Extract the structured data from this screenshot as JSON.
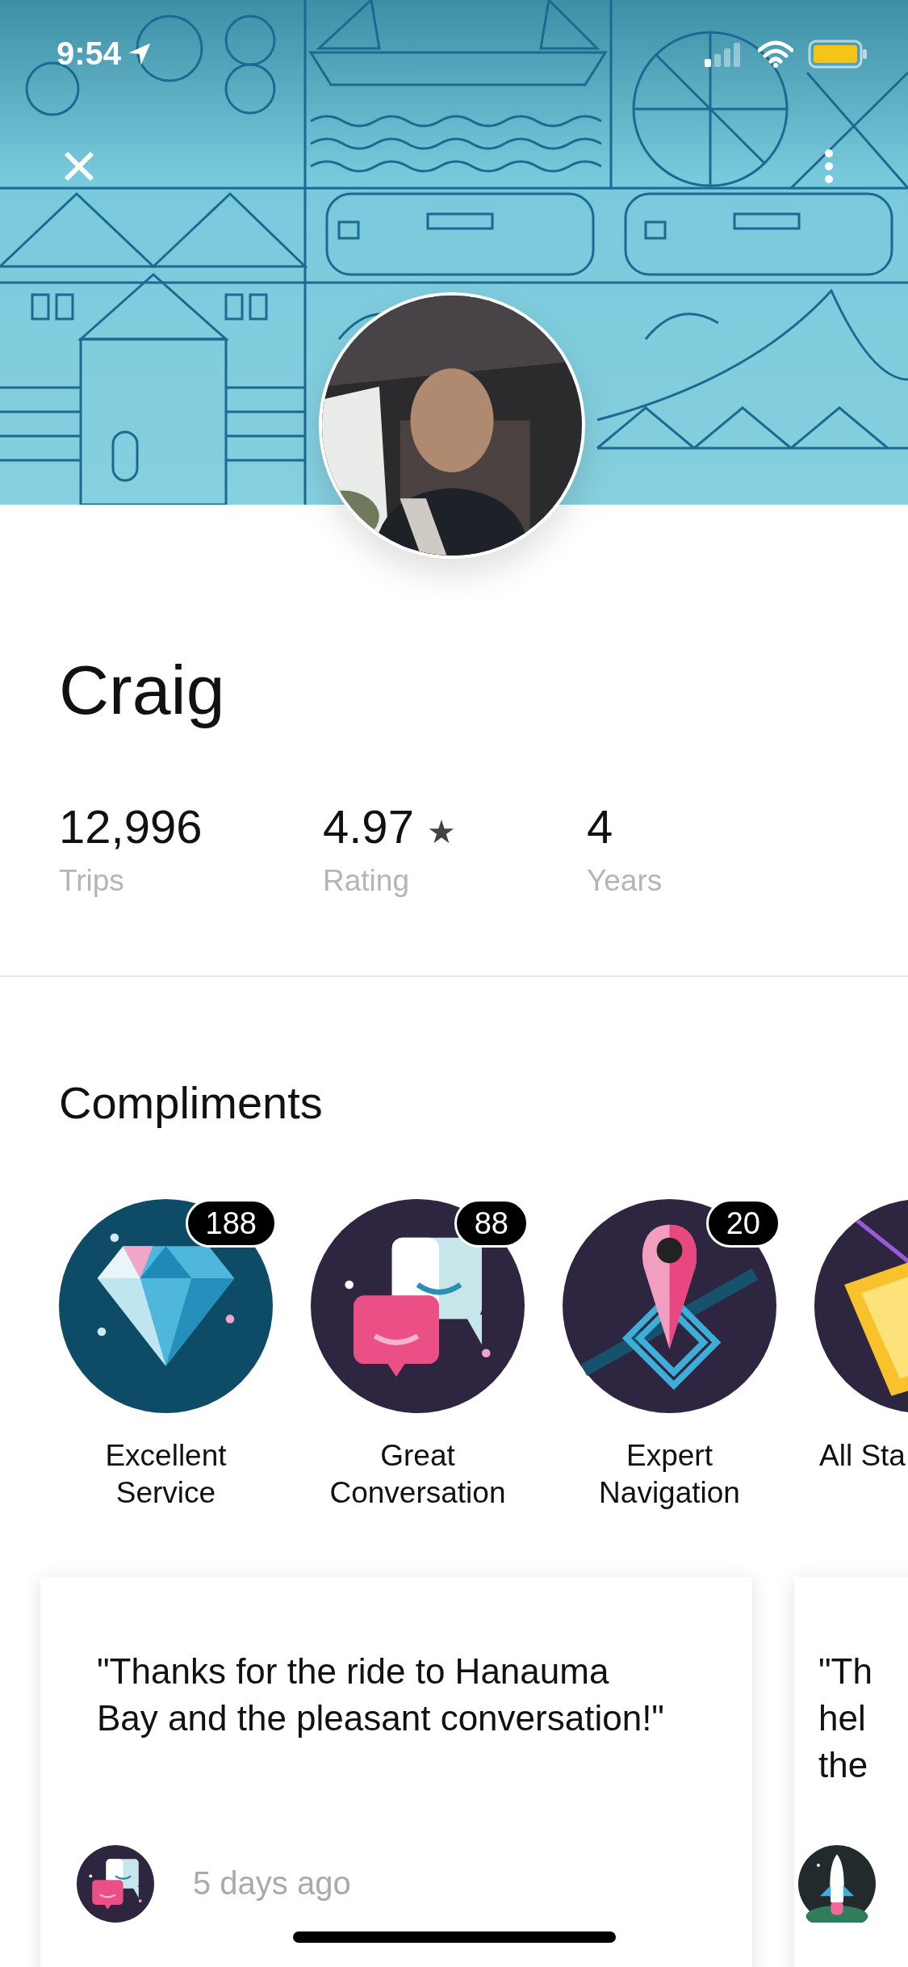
{
  "status_bar": {
    "time": "9:54"
  },
  "profile": {
    "name": "Craig",
    "stats": [
      {
        "value": "12,996",
        "label": "Trips"
      },
      {
        "value": "4.97",
        "suffix": "★",
        "label": "Rating"
      },
      {
        "value": "4",
        "label": "Years"
      }
    ]
  },
  "compliments": {
    "title": "Compliments",
    "badges": [
      {
        "kind": "diamond",
        "count": "188",
        "label": "Excellent Service"
      },
      {
        "kind": "chat",
        "count": "88",
        "label": "Great Conversation"
      },
      {
        "kind": "pin",
        "count": "20",
        "label": "Expert Navigation"
      },
      {
        "kind": "ticket",
        "label": "All Sta"
      }
    ]
  },
  "reviews": [
    {
      "kind": "chat",
      "quote": "\"Thanks for the ride to Hanauma Bay and the pleasant conversation!\"",
      "time": "5 days ago"
    },
    {
      "kind": "rocket",
      "quote": "\"Th\nhel\nthe"
    }
  ]
}
